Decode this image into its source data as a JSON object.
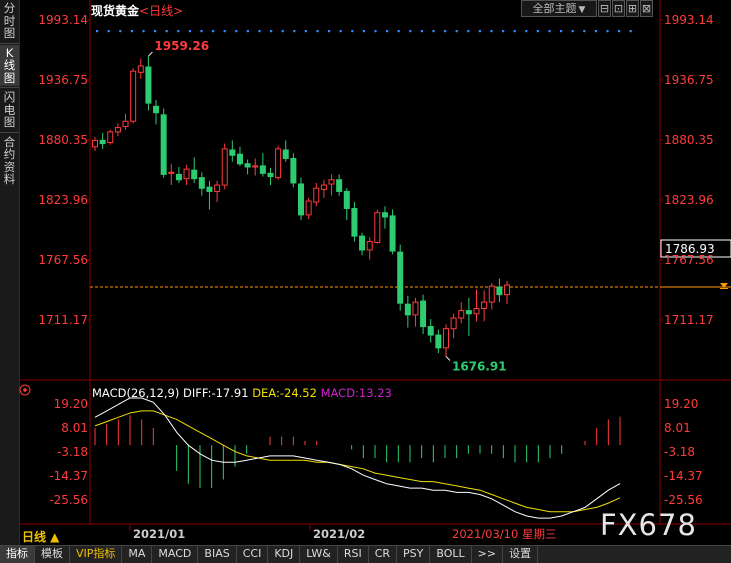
{
  "left_nav": [
    {
      "label": "分时图",
      "active": false
    },
    {
      "label": "K线图",
      "active": true
    },
    {
      "label": "闪电图",
      "active": false
    },
    {
      "label": "合约资料",
      "active": false
    }
  ],
  "header": {
    "instrument": "现货黄金",
    "period_tag": "<日线>",
    "theme_button": "全部主题",
    "theme_arrow": "▼"
  },
  "price_axis": {
    "ticks": [
      "1993.14",
      "1936.75",
      "1880.35",
      "1823.96",
      "1767.56",
      "1711.17"
    ],
    "current_price": "1786.93"
  },
  "annotations": {
    "high": "1959.26",
    "low": "1676.91"
  },
  "macd": {
    "params": "MACD(26,12,9)",
    "diff_text": "DIFF:-17.91",
    "dea_text": "DEA:-24.52",
    "macd_text": "MACD:13.23",
    "ticks": [
      "19.20",
      "8.01",
      "-3.18",
      "-14.37",
      "-25.56"
    ]
  },
  "x_axis": {
    "labels": [
      "2021/01",
      "2021/02"
    ],
    "cursor_label": "2021/03/10 星期三"
  },
  "period_selector": "日线 ▲",
  "watermark": "FX678",
  "bottom_tabs": [
    "指标",
    "模板",
    "VIP指标",
    "MA",
    "MACD",
    "BIAS",
    "CCI",
    "KDJ",
    "LW&",
    "RSI",
    "CR",
    "PSY",
    "BOLL",
    ">>",
    "设置"
  ],
  "colors": {
    "up": "#ff3b3b",
    "down": "#2ecc71",
    "diff": "#ffffff",
    "dea": "#f0e000",
    "macd_label": "#d020d0",
    "accent": "#ff9900"
  },
  "chart_data": [
    {
      "type": "candlestick",
      "title": "现货黄金 日线",
      "ylim": [
        1676.91,
        1993.14
      ],
      "candles": [
        [
          1874,
          1883,
          1870,
          1880
        ],
        [
          1880,
          1887,
          1872,
          1877
        ],
        [
          1878,
          1890,
          1876,
          1888
        ],
        [
          1888,
          1896,
          1884,
          1892
        ],
        [
          1893,
          1905,
          1890,
          1898
        ],
        [
          1898,
          1948,
          1896,
          1945
        ],
        [
          1944,
          1957,
          1938,
          1950
        ],
        [
          1949,
          1959.26,
          1908,
          1915
        ],
        [
          1912,
          1918,
          1895,
          1906
        ],
        [
          1904,
          1910,
          1845,
          1848
        ],
        [
          1849,
          1858,
          1838,
          1850
        ],
        [
          1848,
          1855,
          1840,
          1843
        ],
        [
          1844,
          1857,
          1838,
          1853
        ],
        [
          1852,
          1864,
          1840,
          1844
        ],
        [
          1845,
          1850,
          1828,
          1835
        ],
        [
          1836,
          1842,
          1815,
          1832
        ],
        [
          1832,
          1842,
          1822,
          1838
        ],
        [
          1838,
          1877,
          1834,
          1872
        ],
        [
          1871,
          1880,
          1860,
          1866
        ],
        [
          1867,
          1874,
          1856,
          1858
        ],
        [
          1858,
          1862,
          1848,
          1855
        ],
        [
          1855,
          1863,
          1847,
          1856
        ],
        [
          1856,
          1868,
          1846,
          1849
        ],
        [
          1849,
          1854,
          1838,
          1846
        ],
        [
          1845,
          1875,
          1843,
          1872
        ],
        [
          1871,
          1880,
          1860,
          1863
        ],
        [
          1863,
          1868,
          1836,
          1840
        ],
        [
          1839,
          1845,
          1805,
          1810
        ],
        [
          1810,
          1826,
          1806,
          1823
        ],
        [
          1822,
          1840,
          1818,
          1835
        ],
        [
          1834,
          1843,
          1826,
          1838
        ],
        [
          1839,
          1848,
          1828,
          1843
        ],
        [
          1843,
          1848,
          1828,
          1832
        ],
        [
          1832,
          1835,
          1805,
          1816
        ],
        [
          1816,
          1822,
          1785,
          1790
        ],
        [
          1790,
          1793,
          1772,
          1777
        ],
        [
          1777,
          1789,
          1768,
          1785
        ],
        [
          1784,
          1815,
          1783,
          1812
        ],
        [
          1812,
          1818,
          1797,
          1808
        ],
        [
          1809,
          1815,
          1773,
          1776
        ],
        [
          1775,
          1782,
          1720,
          1727
        ],
        [
          1726,
          1734,
          1704,
          1716
        ],
        [
          1716,
          1732,
          1705,
          1728
        ],
        [
          1729,
          1735,
          1698,
          1705
        ],
        [
          1705,
          1712,
          1690,
          1697
        ],
        [
          1697,
          1702,
          1680,
          1685
        ],
        [
          1685,
          1707,
          1676.91,
          1703
        ],
        [
          1703,
          1717,
          1694,
          1713
        ],
        [
          1713,
          1728,
          1708,
          1720
        ],
        [
          1720,
          1732,
          1696,
          1717
        ],
        [
          1717,
          1740,
          1710,
          1722
        ],
        [
          1722,
          1739,
          1710,
          1728
        ],
        [
          1728,
          1746,
          1721,
          1743
        ],
        [
          1742,
          1750,
          1728,
          1735
        ],
        [
          1735,
          1748,
          1726,
          1744
        ]
      ]
    },
    {
      "type": "macd",
      "title": "MACD(26,12,9)",
      "ylim": [
        -30,
        26
      ],
      "diff": [
        13,
        16,
        19,
        22,
        22,
        20,
        14,
        6,
        0,
        -4,
        -7,
        -8,
        -8,
        -7,
        -6,
        -5,
        -5,
        -5,
        -6,
        -7,
        -8,
        -9,
        -11,
        -14,
        -16,
        -18,
        -19,
        -20,
        -20,
        -21,
        -21,
        -22,
        -22,
        -23,
        -25,
        -28,
        -31,
        -33,
        -34,
        -34,
        -33,
        -31,
        -29,
        -25,
        -21,
        -17.91
      ],
      "dea": [
        9,
        11,
        13,
        15,
        16,
        16,
        14,
        12,
        9,
        6,
        3,
        0,
        -3,
        -5,
        -6,
        -7,
        -7,
        -7,
        -7,
        -8,
        -8,
        -9,
        -10,
        -11,
        -13,
        -14,
        -15,
        -16,
        -17,
        -17,
        -18,
        -19,
        -20,
        -21,
        -23,
        -25,
        -27,
        -29,
        -30,
        -31,
        -31,
        -31,
        -30,
        -29,
        -27,
        -24.52
      ],
      "macd_hist": [
        8,
        10,
        12,
        14,
        12,
        8,
        0,
        -12,
        -18,
        -20,
        -20,
        -16,
        -10,
        -4,
        0,
        4,
        4,
        4,
        2,
        2,
        0,
        0,
        -2,
        -6,
        -6,
        -8,
        -8,
        -8,
        -6,
        -8,
        -6,
        -6,
        -4,
        -4,
        -4,
        -6,
        -8,
        -8,
        -8,
        -6,
        -4,
        0,
        2,
        8,
        12,
        13.23
      ]
    }
  ]
}
